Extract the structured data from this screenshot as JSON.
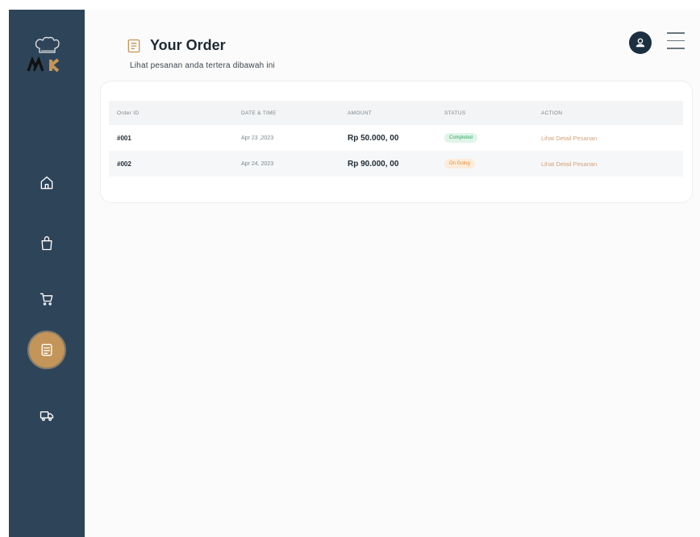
{
  "brand": {
    "logo_text": "MK",
    "accent_color": "#c49559",
    "sidebar_color": "#2e4459"
  },
  "sidebar": {
    "items": [
      {
        "name": "home",
        "icon": "home-icon",
        "active": false
      },
      {
        "name": "bag",
        "icon": "shopping-bag-icon",
        "active": false
      },
      {
        "name": "cart",
        "icon": "cart-icon",
        "active": false
      },
      {
        "name": "orders",
        "icon": "order-list-icon",
        "active": true
      },
      {
        "name": "delivery",
        "icon": "truck-icon",
        "active": false
      }
    ]
  },
  "header": {
    "title": "Your Order",
    "subtitle": "Lihat pesanan anda tertera dibawah ini",
    "title_icon": "order-list-icon",
    "avatar_icon": "user-icon",
    "menu_icon": "hamburger-menu-icon"
  },
  "orders_table": {
    "columns": [
      "Order ID",
      "DATE & TIME",
      "AMOUNT",
      "STATUS",
      "ACTION"
    ],
    "rows": [
      {
        "order_id": "#001",
        "date": "Apr 23 ,2023",
        "amount": "Rp 50.000, 00",
        "status": "Completed",
        "status_color": "#3aa36b",
        "action": "Lihat Detail Pesanan"
      },
      {
        "order_id": "#002",
        "date": "Apr 24, 2023",
        "amount": "Rp 90.000, 00",
        "status": "On Going",
        "status_color": "#e08b3a",
        "action": "Lihat Detail Pesanan"
      }
    ]
  }
}
